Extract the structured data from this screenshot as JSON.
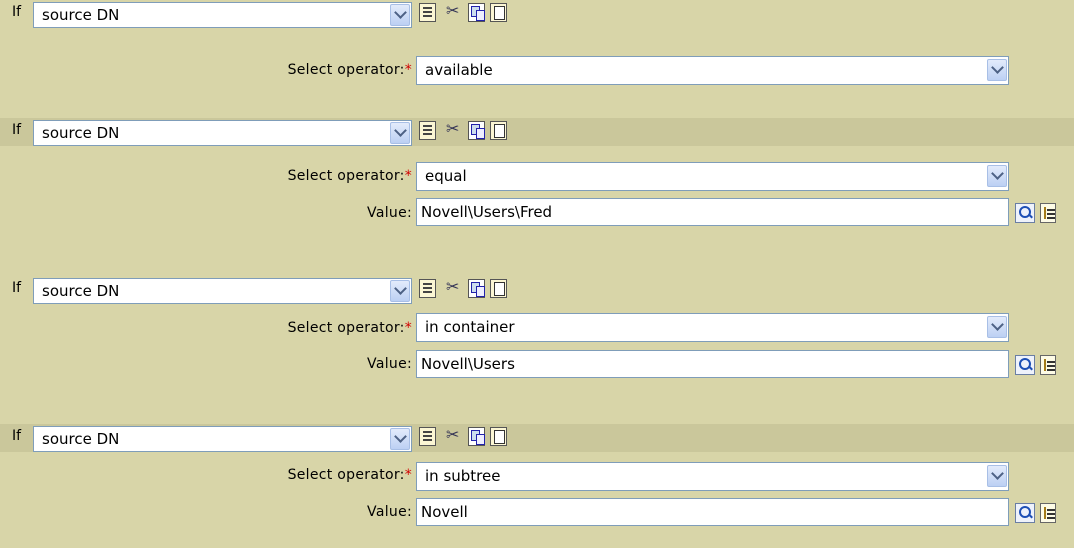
{
  "conditions": [
    {
      "if_label": "If",
      "source": "source DN",
      "operator_label": "Select operator:",
      "required_mark": "*",
      "operator": "available"
    },
    {
      "if_label": "If",
      "source": "source DN",
      "operator_label": "Select operator:",
      "required_mark": "*",
      "operator": "equal",
      "value_label": "Value:",
      "value": "Novell\\Users\\Fred"
    },
    {
      "if_label": "If",
      "source": "source DN",
      "operator_label": "Select operator:",
      "required_mark": "*",
      "operator": "in container",
      "value_label": "Value:",
      "value": "Novell\\Users"
    },
    {
      "if_label": "If",
      "source": "source DN",
      "operator_label": "Select operator:",
      "required_mark": "*",
      "operator": "in subtree",
      "value_label": "Value:",
      "value": "Novell"
    }
  ],
  "icons": [
    "properties-icon",
    "cut-icon",
    "copy-icon",
    "paste-icon",
    "search-icon",
    "browse-tree-icon"
  ],
  "colors": {
    "panel": "#d8d5a8",
    "header_shade": "#cac79b",
    "border": "#7f9db9",
    "required": "#d10000"
  }
}
